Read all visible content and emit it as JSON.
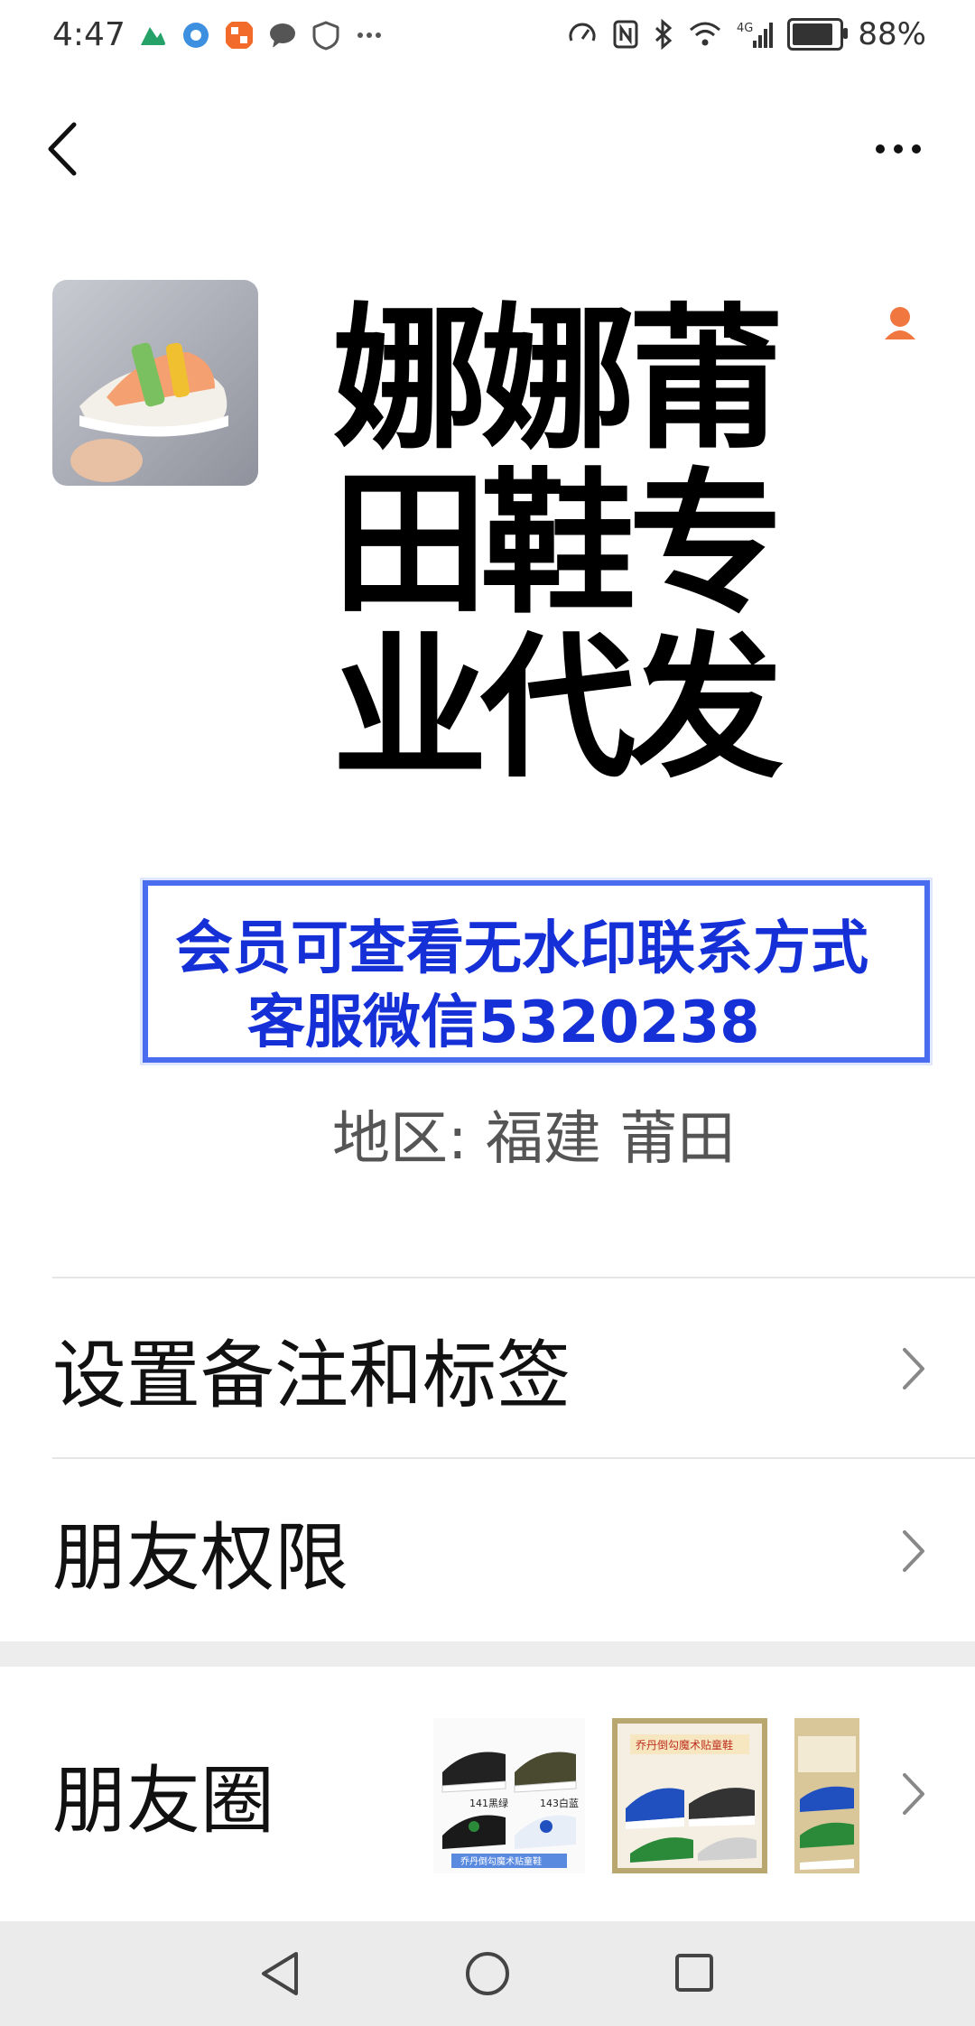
{
  "status_bar": {
    "time": "4:47",
    "battery_percent": "88%",
    "battery_level": 0.88,
    "network": "4G",
    "icons_left": [
      "maps-icon",
      "browser-icon",
      "app-icon",
      "message-icon",
      "shield-icon",
      "more-icon"
    ],
    "icons_right": [
      "speed-icon",
      "nfc-icon",
      "bluetooth-icon",
      "wifi-icon",
      "signal-icon",
      "battery-icon"
    ]
  },
  "profile": {
    "name": "娜娜莆田鞋专业代发",
    "watermark_line1": "会员可查看无水印联系方式",
    "watermark_line2": "客服微信5320238",
    "region": "地区:  福建  莆田"
  },
  "menu": {
    "remarks_label": "设置备注和标签",
    "permissions_label": "朋友权限",
    "moments_label": "朋友圈"
  },
  "moments_thumbs": {
    "thumb1_labels": [
      "141黑绿",
      "143白蓝",
      "乔丹倒勾魔术贴童鞋"
    ],
    "thumb2_label": "乔丹倒勾魔术贴童鞋"
  },
  "colors": {
    "watermark_blue": "#1630d8",
    "accent_orange": "#f07840"
  }
}
